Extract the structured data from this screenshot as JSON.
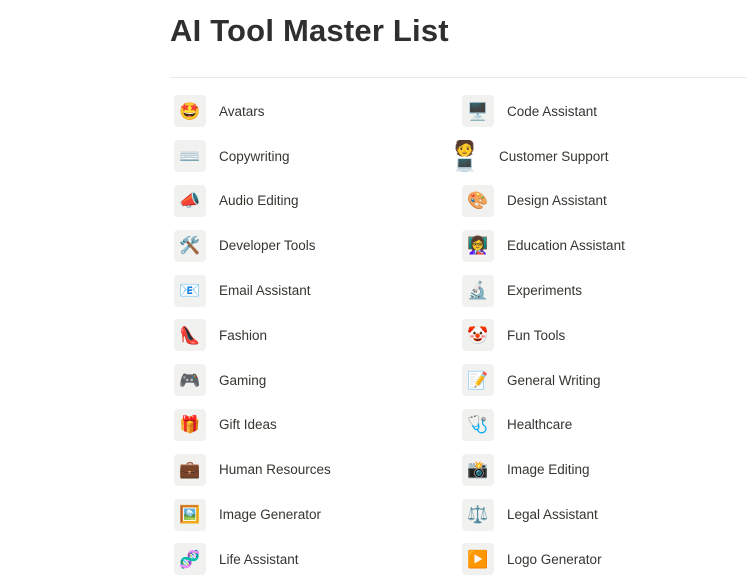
{
  "page": {
    "title": "AI Tool Master List"
  },
  "left_column": [
    {
      "icon": "star-struck-face-icon",
      "glyph": "🤩",
      "label": "Avatars"
    },
    {
      "icon": "keyboard-icon",
      "glyph": "⌨️",
      "label": "Copywriting"
    },
    {
      "icon": "megaphone-icon",
      "glyph": "📣",
      "label": "Audio Editing"
    },
    {
      "icon": "hammer-wrench-icon",
      "glyph": "🛠️",
      "label": "Developer Tools"
    },
    {
      "icon": "envelope-icon",
      "glyph": "📧",
      "label": "Email Assistant"
    },
    {
      "icon": "high-heel-icon",
      "glyph": "👠",
      "label": "Fashion"
    },
    {
      "icon": "gamepad-icon",
      "glyph": "🎮",
      "label": "Gaming"
    },
    {
      "icon": "gift-icon",
      "glyph": "🎁",
      "label": "Gift Ideas"
    },
    {
      "icon": "briefcase-icon",
      "glyph": "💼",
      "label": "Human Resources"
    },
    {
      "icon": "framed-picture-icon",
      "glyph": "🖼️",
      "label": "Image Generator"
    },
    {
      "icon": "dna-icon",
      "glyph": "🧬",
      "label": "Life Assistant"
    }
  ],
  "right_column": [
    {
      "icon": "desktop-computer-icon",
      "glyph": "🖥️",
      "label": "Code Assistant"
    },
    {
      "icon": "person-laptop-icon",
      "glyph": "🧑💻",
      "label": "Customer Support",
      "bare": true
    },
    {
      "icon": "artist-palette-icon",
      "glyph": "🎨",
      "label": "Design Assistant"
    },
    {
      "icon": "teacher-icon",
      "glyph": "👩‍🏫",
      "label": "Education Assistant"
    },
    {
      "icon": "microscope-icon",
      "glyph": "🔬",
      "label": "Experiments"
    },
    {
      "icon": "clown-face-icon",
      "glyph": "🤡",
      "label": "Fun Tools"
    },
    {
      "icon": "memo-icon",
      "glyph": "📝",
      "label": "General Writing"
    },
    {
      "icon": "stethoscope-icon",
      "glyph": "🩺",
      "label": "Healthcare"
    },
    {
      "icon": "camera-flash-icon",
      "glyph": "📸",
      "label": "Image Editing"
    },
    {
      "icon": "balance-scale-icon",
      "glyph": "⚖️",
      "label": "Legal Assistant"
    },
    {
      "icon": "play-button-icon",
      "glyph": "▶️",
      "label": "Logo Generator"
    }
  ]
}
